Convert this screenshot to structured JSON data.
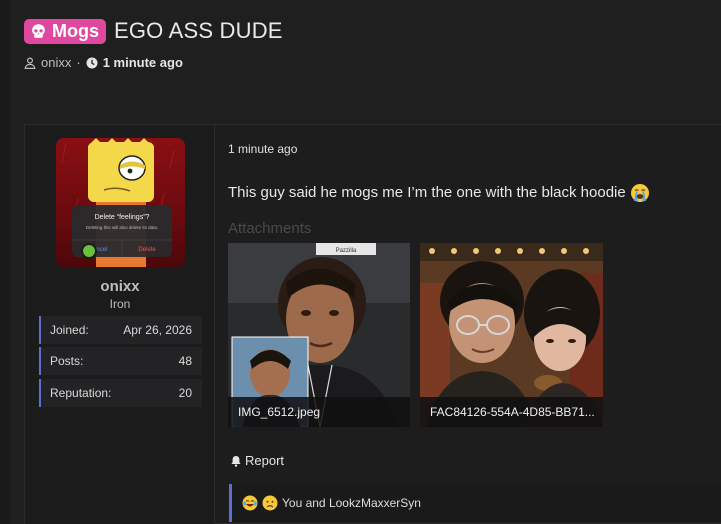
{
  "thread": {
    "prefix": "Mogs",
    "title": "EGO ASS DUDE",
    "author": "onixx",
    "time": "1 minute ago"
  },
  "user": {
    "name": "onixx",
    "rank": "Iron",
    "stats": [
      {
        "label": "Joined:",
        "value": "Apr 26, 2026"
      },
      {
        "label": "Posts:",
        "value": "48"
      },
      {
        "label": "Reputation:",
        "value": "20"
      }
    ],
    "avatar_dialog": {
      "title": "Delete “feelings”?",
      "body": "Deleting this will also delete its data.",
      "cancel": "Cancel",
      "delete": "Delete"
    }
  },
  "post": {
    "time": "1 minute ago",
    "body": "This guy said he mogs me I’m the one with the black hoodie",
    "attachments_label": "Attachments",
    "attachments": [
      {
        "filename": "IMG_6512.jpeg",
        "overlay_text": "Pazzilla"
      },
      {
        "filename": "FAC84126-554A-4D85-BB71..."
      }
    ],
    "report_label": "Report",
    "reactions_text": "You and LookzMaxxerSyn"
  },
  "colors": {
    "prefix": "#e0479e",
    "accent": "#5a6fd0",
    "online": "#6bbf3a"
  }
}
